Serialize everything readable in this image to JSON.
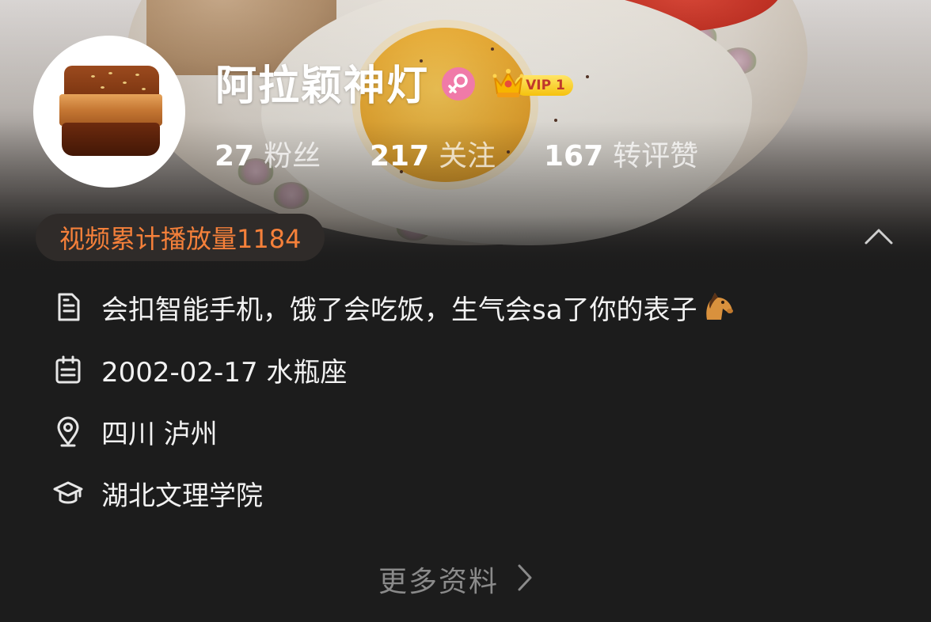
{
  "profile": {
    "name": "阿拉颖神灯",
    "gender_icon": "female-icon",
    "vip_badge": "VIP 1"
  },
  "stats": [
    {
      "count": "27",
      "label": "粉丝"
    },
    {
      "count": "217",
      "label": "关注"
    },
    {
      "count": "167",
      "label": "转评赞"
    }
  ],
  "play_count_text": "视频累计播放量1184",
  "info": {
    "bio": "会扣智能手机，饿了会吃饭，生气会sa了你的表子",
    "birthday": "2002-02-17 水瓶座",
    "location": "四川 泸州",
    "school": "湖北文理学院"
  },
  "more_link": "更多资料",
  "colors": {
    "background": "#1c1c1c",
    "accent_orange": "#f5803a",
    "vip_gold": "#f5c20e",
    "female_pink": "#f07aa8"
  }
}
